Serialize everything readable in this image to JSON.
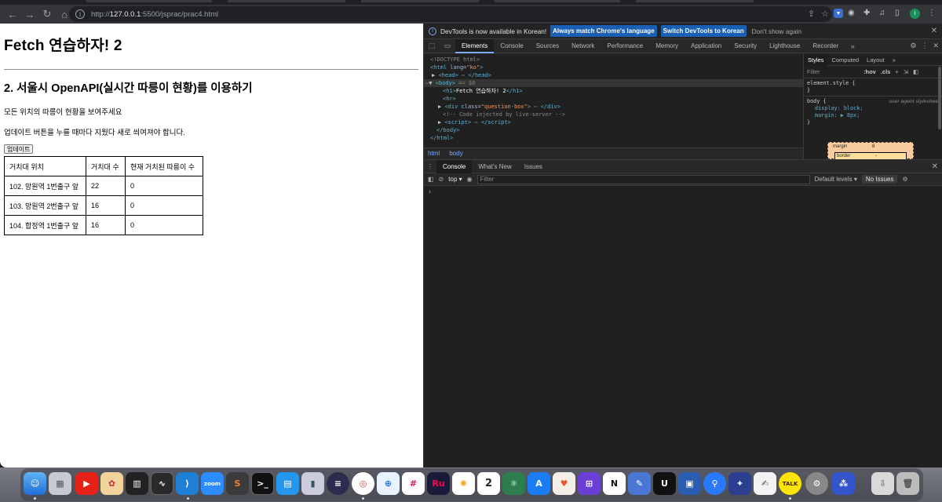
{
  "browser": {
    "url_prefix": "http://",
    "url_host": "127.0.0.1",
    "url_rest": ":5500/jsprac/prac4.html",
    "profile_initial": "I"
  },
  "page": {
    "h1": "Fetch 연습하자! 2",
    "h2": "2. 서울시 OpenAPI(실시간 따릉이 현황)를 이용하기",
    "p1": "모든 위치의 따릉이 현황을 보여주세요",
    "p2": "업데이트 버튼을 누를 때마다 지웠다 새로 씌여져야 합니다.",
    "update_button": "업데이트",
    "table": {
      "headers": [
        "거치대 위치",
        "거치대 수",
        "현재 거치된 따릉이 수"
      ],
      "rows": [
        [
          "102. 망원역 1번출구 앞",
          "22",
          "0"
        ],
        [
          "103. 망원역 2번출구 앞",
          "16",
          "0"
        ],
        [
          "104. 합정역 1번출구 앞",
          "16",
          "0"
        ]
      ]
    }
  },
  "devtools": {
    "info_message": "DevTools is now available in Korean!",
    "match_button": "Always match Chrome's language",
    "switch_button": "Switch DevTools to Korean",
    "dont_show": "Don't show again",
    "tabs": [
      "Elements",
      "Console",
      "Sources",
      "Network",
      "Performance",
      "Memory",
      "Application",
      "Security",
      "Lighthouse",
      "Recorder"
    ],
    "active_tab": "Elements",
    "breadcrumbs": [
      "html",
      "body"
    ],
    "styles_tabs": [
      "Styles",
      "Computed",
      "Layout"
    ],
    "styles_filter_placeholder": "Filter",
    "hov_label": ":hov",
    "cls_label": ".cls",
    "element_style": "element.style {",
    "body_selector": "body {",
    "user_agent": "user agent stylesheet",
    "prop1": "display: block;",
    "prop2": "margin: ▶ 8px;",
    "close_brace": "}",
    "margin_label": "margin",
    "margin_value": "8",
    "border_label": "border",
    "border_value": "-",
    "drawer_tabs": [
      "Console",
      "What's New",
      "Issues"
    ],
    "console_context": "top",
    "console_filter_placeholder": "Filter",
    "default_levels": "Default levels",
    "no_issues": "No Issues",
    "prompt": "›"
  },
  "dock": {
    "zoom_label": "zoom",
    "ru_label": "Ru",
    "calendar_day": "2",
    "notion_label": "N",
    "talk_label": "TALK"
  },
  "colors": {
    "accent_blue": "#7cacf8",
    "info_button_blue": "#1a5fb4",
    "devtools_bg": "#282828",
    "page_bg": "#ffffff"
  }
}
